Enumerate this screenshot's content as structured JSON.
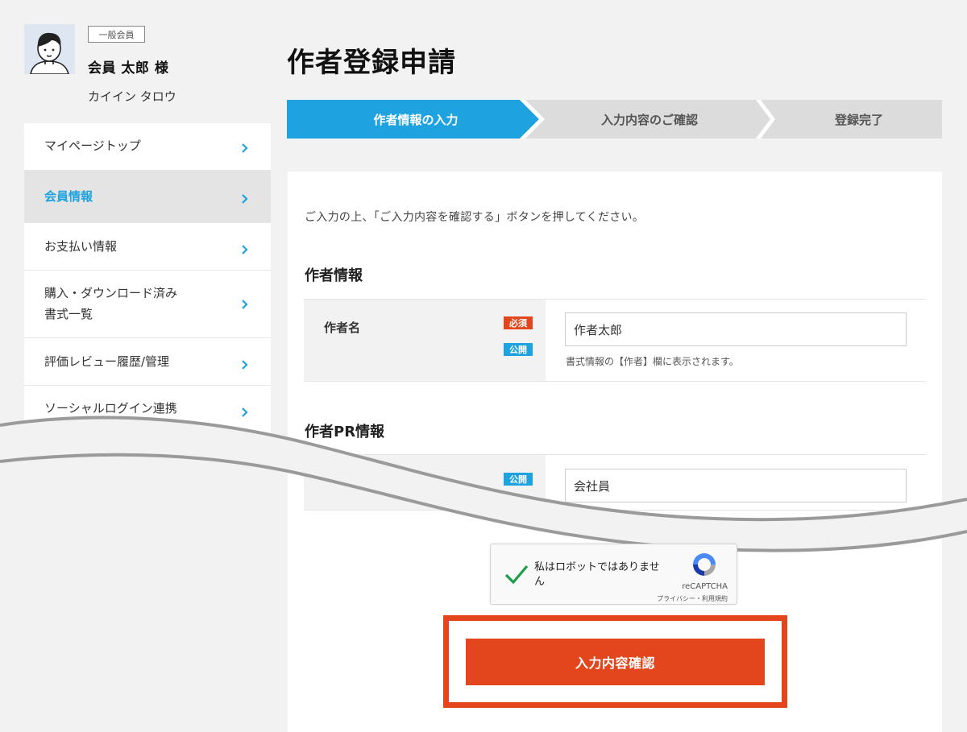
{
  "profile": {
    "member_badge": "一般会員",
    "name": "会員 太郎 様",
    "kana": "カイイン タロウ"
  },
  "sidebar": {
    "items": [
      {
        "label": "マイページトップ"
      },
      {
        "label": "会員情報"
      },
      {
        "label": "お支払い情報"
      },
      {
        "label": "購入・ダウンロード済み書式一覧",
        "line1": "購入・ダウンロード済み",
        "line2": "書式一覧"
      },
      {
        "label": "評価レビュー履歴/管理"
      },
      {
        "label": "ソーシャルログイン連携"
      }
    ]
  },
  "page": {
    "title": "作者登録申請"
  },
  "steps": [
    {
      "label": "作者情報の入力"
    },
    {
      "label": "入力内容のご確認"
    },
    {
      "label": "登録完了"
    }
  ],
  "form": {
    "intro": "ご入力の上、「ご入力内容を確認する」ボタンを押してください。",
    "section_author": "作者情報",
    "author_name_label": "作者名",
    "tag_required": "必須",
    "tag_public": "公開",
    "author_name_value": "作者太郎",
    "author_name_help": "書式情報の【作者】欄に表示されます。",
    "section_pr": "作者PR情報",
    "pr_value": "会社員"
  },
  "recaptcha": {
    "text": "私はロボットではありません",
    "brand": "reCAPTCHA",
    "links": "プライバシー・利用規約"
  },
  "submit": {
    "label": "入力内容確認"
  },
  "colors": {
    "accent_blue": "#1fa3e0",
    "accent_red": "#e3451c",
    "step_inactive": "#dcdcdc"
  }
}
